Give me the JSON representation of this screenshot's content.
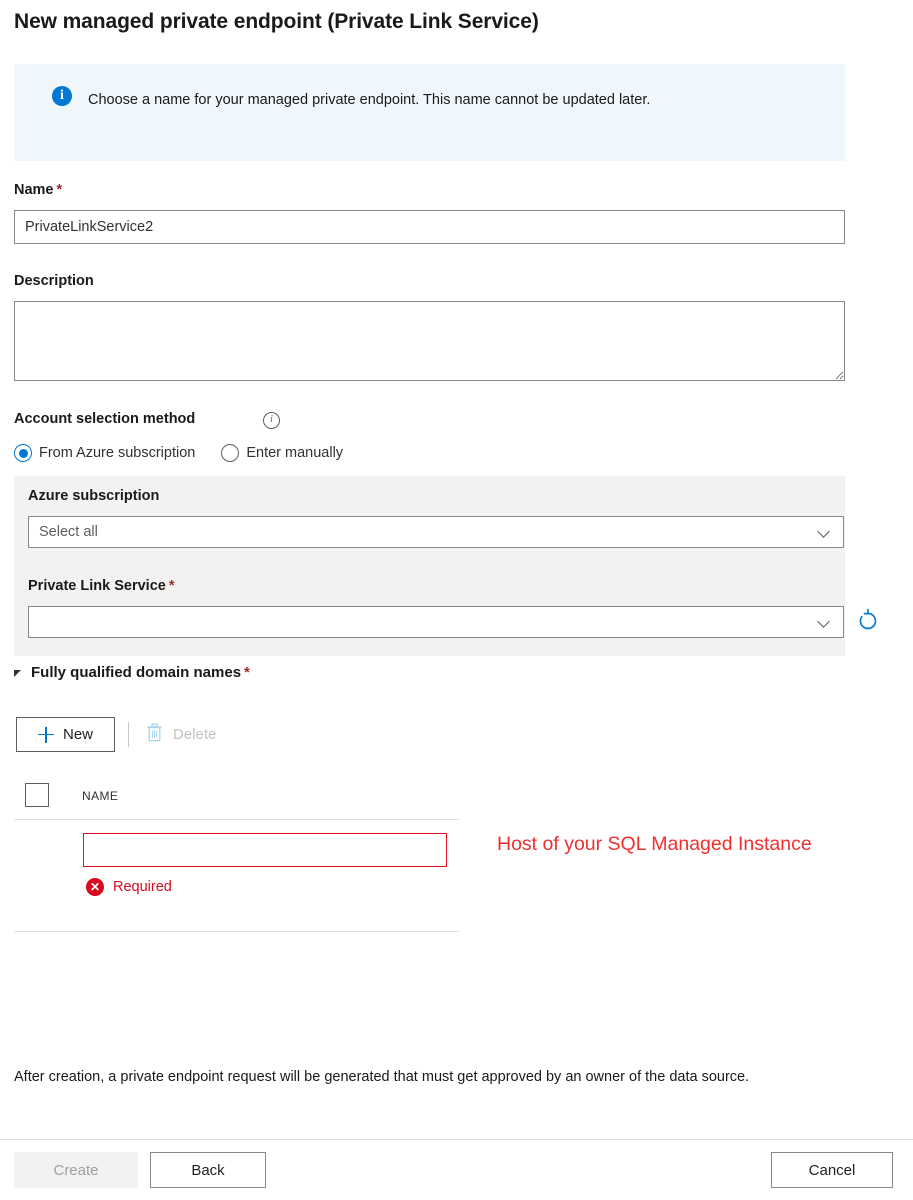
{
  "page": {
    "title": "New managed private endpoint (Private Link Service)"
  },
  "info_banner": {
    "icon": "info-icon",
    "text": "Choose a name for your managed private endpoint. This name cannot be updated later."
  },
  "form": {
    "name": {
      "label": "Name",
      "required_marker": "*",
      "value": "PrivateLinkService2",
      "placeholder": ""
    },
    "description": {
      "label": "Description",
      "value": "",
      "placeholder": ""
    },
    "account_selection": {
      "label": "Account selection method",
      "info_icon": "info-circle-icon",
      "options": [
        {
          "label": "From Azure subscription",
          "selected": true
        },
        {
          "label": "Enter manually",
          "selected": false
        }
      ]
    },
    "azure_subscription": {
      "label": "Azure subscription",
      "value": "Select all",
      "chevron": "chevron-down-icon"
    },
    "private_link_service": {
      "label": "Private Link Service",
      "required_marker": "*",
      "value": "",
      "chevron": "chevron-down-icon",
      "refresh_icon": "refresh-icon"
    }
  },
  "fqdn_section": {
    "title": "Fully qualified domain names",
    "required_marker": "*",
    "expanded": true,
    "collapse_icon": "triangle-expanded-icon",
    "toolbar": {
      "new_label": "New",
      "new_icon": "plus-icon",
      "delete_label": "Delete",
      "delete_icon": "trash-icon",
      "delete_disabled": true
    },
    "table": {
      "columns": [
        "NAME"
      ],
      "rows": [
        {
          "name_value": "",
          "error": "Required",
          "error_icon": "error-circle-icon"
        }
      ]
    }
  },
  "annotation": {
    "text": "Host of your SQL Managed Instance",
    "color": "#f03030"
  },
  "footer": {
    "note": "After creation, a private endpoint request will be generated that must get approved by an owner of the data source.",
    "buttons": {
      "create": "Create",
      "back": "Back",
      "cancel": "Cancel"
    }
  },
  "colors": {
    "accent": "#0078d4",
    "banner_bg": "#eff6fc",
    "panel_bg": "#f3f2f1",
    "error": "#e81123",
    "required_star": "#a4262c"
  }
}
